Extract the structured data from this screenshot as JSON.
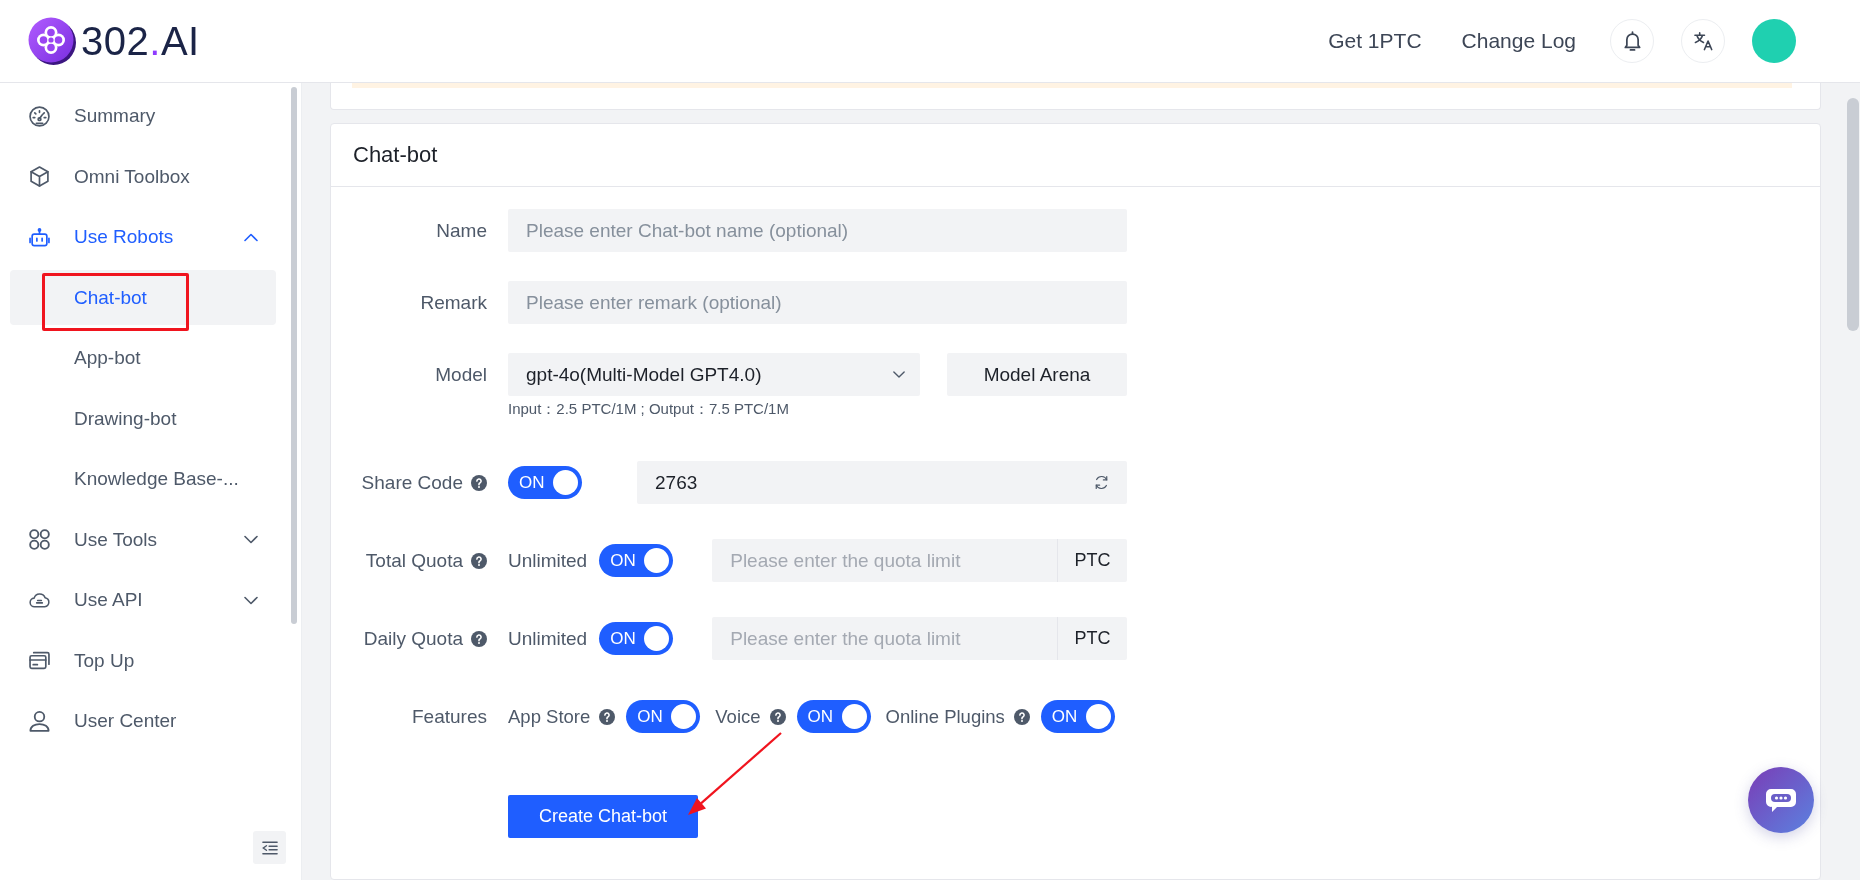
{
  "header": {
    "logo": [
      {
        "text": "302",
        "accent": false
      },
      {
        "text": ".",
        "accent": true
      },
      {
        "text": "AI",
        "accent": false
      }
    ],
    "links": [
      "Get 1PTC",
      "Change Log"
    ]
  },
  "sidebar": {
    "items": [
      {
        "kind": "link",
        "label": "Summary",
        "selected": false
      },
      {
        "kind": "link",
        "label": "Omni Toolbox",
        "selected": false
      },
      {
        "kind": "group",
        "label": "Use Robots",
        "selected": true,
        "expanded": true,
        "children": [
          {
            "label": "Chat-bot",
            "selected": true
          },
          {
            "label": "App-bot",
            "selected": false
          },
          {
            "label": "Drawing-bot",
            "selected": false
          },
          {
            "label": "Knowledge Base-...",
            "selected": false
          }
        ]
      },
      {
        "kind": "group",
        "label": "Use Tools",
        "selected": false,
        "expanded": false
      },
      {
        "kind": "group",
        "label": "Use API",
        "selected": false,
        "expanded": false
      },
      {
        "kind": "link",
        "label": "Top Up",
        "selected": false
      },
      {
        "kind": "link",
        "label": "User Center",
        "selected": false
      }
    ]
  },
  "card": {
    "title": "Chat-bot",
    "rows": [
      {
        "kind": "text",
        "label": "Name",
        "help": false,
        "placeholder": "Please enter Chat-bot name (optional)"
      },
      {
        "kind": "text",
        "label": "Remark",
        "help": false,
        "placeholder": "Please enter remark (optional)"
      },
      {
        "kind": "select",
        "label": "Model",
        "help": false,
        "value": "gpt-4o(Multi-Model GPT4.0)",
        "button": "Model Arena",
        "hint": "Input：2.5 PTC/1M ; Output：7.5 PTC/1M"
      },
      {
        "kind": "share",
        "label": "Share Code",
        "help": true,
        "toggle": {
          "text": "ON",
          "on": true
        },
        "value": "2763"
      },
      {
        "kind": "quota",
        "label": "Total Quota",
        "help": true,
        "option": "Unlimited",
        "toggle": {
          "text": "ON",
          "on": true
        },
        "placeholder": "Please enter the quota limit",
        "disabled": true,
        "unit": "PTC"
      },
      {
        "kind": "quota",
        "label": "Daily Quota",
        "help": true,
        "option": "Unlimited",
        "toggle": {
          "text": "ON",
          "on": true
        },
        "placeholder": "Please enter the quota limit",
        "disabled": true,
        "unit": "PTC"
      },
      {
        "kind": "features",
        "label": "Features",
        "help": false,
        "features": [
          {
            "label": "App Store",
            "help": true,
            "toggle": {
              "text": "ON",
              "on": true
            }
          },
          {
            "label": "Voice",
            "help": true,
            "toggle": {
              "text": "ON",
              "on": true
            }
          },
          {
            "label": "Online Plugins",
            "help": true,
            "toggle": {
              "text": "ON",
              "on": true
            }
          }
        ]
      }
    ],
    "submit": "Create Chat-bot"
  }
}
